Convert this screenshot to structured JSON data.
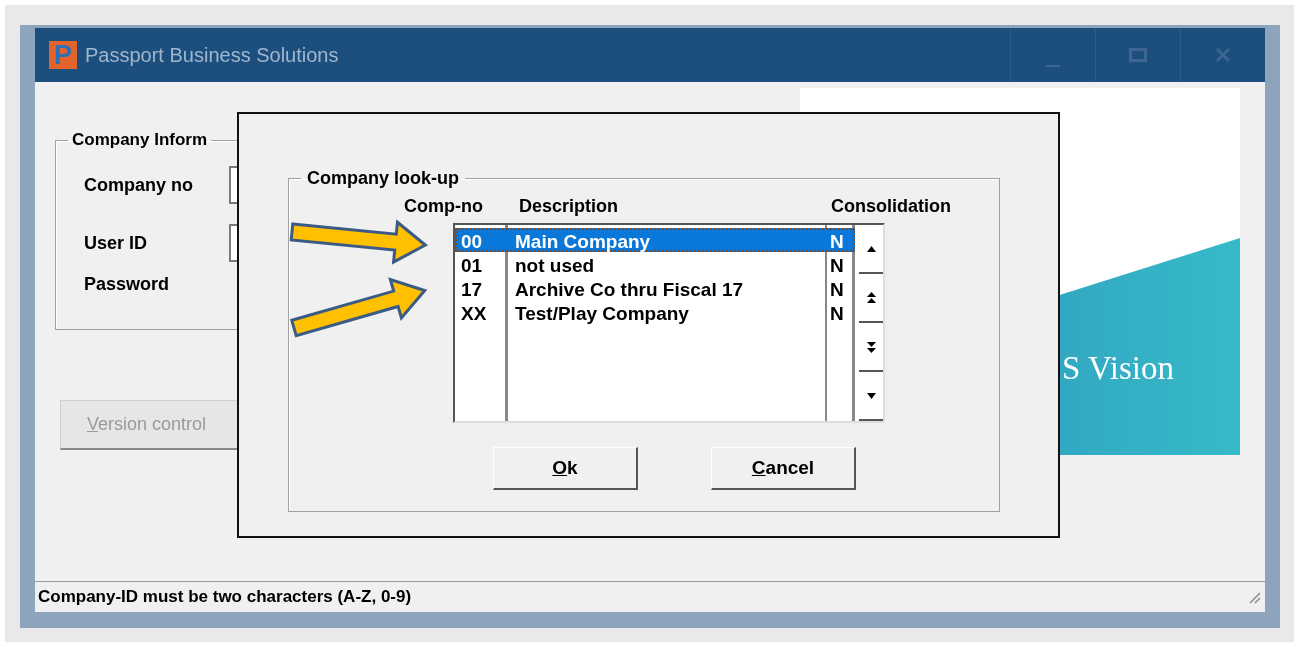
{
  "window": {
    "title": "Passport Business Solutions",
    "icon_letter": "P"
  },
  "company_information": {
    "title": "Company Inform",
    "fields": [
      {
        "label": "Company no"
      },
      {
        "label": "User ID"
      },
      {
        "label": "Password"
      }
    ]
  },
  "buttons": [
    {
      "label": "Version control",
      "disabled": true
    }
  ],
  "banner": {
    "text": "S Vision"
  },
  "lookup": {
    "title": "Company look-up",
    "columns": [
      "Comp-no",
      "Description",
      "Consolidation"
    ],
    "rows": [
      {
        "comp_no": "00",
        "description": "Main Company",
        "consolidation": "N",
        "selected": true
      },
      {
        "comp_no": "01",
        "description": "not used",
        "consolidation": "N",
        "selected": false
      },
      {
        "comp_no": "17",
        "description": "Archive Co thru Fiscal 17",
        "consolidation": "N",
        "selected": false
      },
      {
        "comp_no": "XX",
        "description": "Test/Play Company",
        "consolidation": "N",
        "selected": false
      }
    ],
    "buttons": [
      {
        "label": "Ok"
      },
      {
        "label": "Cancel"
      }
    ]
  },
  "status_bar": {
    "text": "Company-ID must be two characters (A-Z, 0-9)"
  }
}
